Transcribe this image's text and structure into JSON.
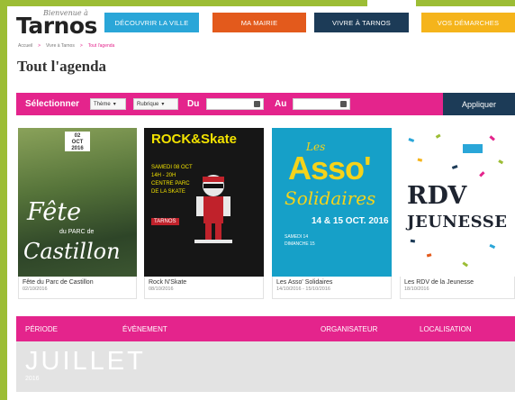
{
  "site": {
    "logo_small": "Bienvenue à",
    "logo_main": "Tarnos"
  },
  "nav": [
    {
      "label": "Découvrir la ville",
      "color": "#2aa6d8"
    },
    {
      "label": "Ma mairie",
      "color": "#e35a1c"
    },
    {
      "label": "Vivre à Tarnos",
      "color": "#1c3b57"
    },
    {
      "label": "Vos démarches",
      "color": "#f5b41b"
    }
  ],
  "breadcrumb": {
    "home": "Accueil",
    "level1": "Vivre à Tarnos",
    "current": "Tout l'agenda",
    "sep": ">"
  },
  "page_title": "Tout l'agenda",
  "filter": {
    "label": "Sélectionner",
    "theme": "Thème",
    "rubrique": "Rubrique",
    "from_label": "Du",
    "to_label": "Au",
    "apply": "Appliquer"
  },
  "events": [
    {
      "title": "Fête du Parc de Castillon",
      "date": "02/10/2016",
      "poster": {
        "badge_line1": "02",
        "badge_line2": "OCT",
        "badge_line3": "2016",
        "line1": "Fête",
        "line2": "du PARC de",
        "line3": "Castillon"
      }
    },
    {
      "title": "Rock N'Skate",
      "date": "08/10/2016",
      "poster": {
        "heading": "ROCK&Skate",
        "info1": "SAMEDI 08 OCT",
        "info2": "14H - 20H",
        "info3": "CENTRE PARC",
        "info4": "DE LA SKATE",
        "tag": "TARNOS"
      }
    },
    {
      "title": "Les Asso' Solidaires",
      "date": "14/10/2016 - 15/10/2016",
      "poster": {
        "les": "Les",
        "asso": "Asso'",
        "solidaires": "Solidaires",
        "dates": "14 & 15 OCT. 2016",
        "row1": "SAMEDI 14",
        "row2": "DIMANCHE 15"
      }
    },
    {
      "title": "Les RDV de la Jeunesse",
      "date": "18/10/2016",
      "poster": {
        "line1": "RDV",
        "line2": "JEUNESSE"
      }
    }
  ],
  "table": {
    "col_period": "Période",
    "col_event": "Évènement",
    "col_organizer": "Organisateur",
    "col_location": "Localisation"
  },
  "month": {
    "name": "JUILLET",
    "year": "2016"
  },
  "colors": {
    "green": "#9cbd35",
    "magenta": "#e4248c",
    "navy": "#1c3b57"
  }
}
